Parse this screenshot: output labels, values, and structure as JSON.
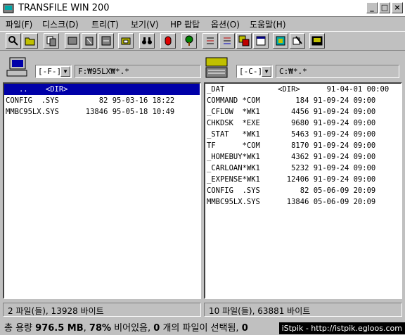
{
  "window": {
    "title": "TRANSFILE WIN 200",
    "minimize": "_",
    "maximize": "□",
    "close": "×"
  },
  "menu": [
    "파일(F)",
    "디스크(D)",
    "트리(T)",
    "보기(V)",
    "HP 팝탑",
    "옵션(O)",
    "도움말(H)"
  ],
  "toolbar_icons": [
    "magnify-icon",
    "open-folder-icon",
    "copy-icon",
    "move-icon",
    "delete-icon",
    "rename-icon",
    "tree-icon",
    "binoculars-icon",
    "stop-icon",
    "tree-view-icon",
    "sort-az-icon",
    "sort-za-icon",
    "tile-icon",
    "calendar-icon",
    "info-icon",
    "connect-icon",
    "exit-icon"
  ],
  "left": {
    "drive": "[-F-]",
    "path": "F:₩95LX₩*.*",
    "files": [
      "   ..    <DIR>",
      "CONFIG  .SYS         82 95-03-16 18:22",
      "MMBC95LX.SYS      13846 95-05-18 10:49"
    ],
    "selected_index": 0,
    "status": "2 파일(들), 13928 바이트"
  },
  "right": {
    "drive": "[-C-]",
    "path": "C:₩*.*",
    "files": [
      "_DAT            <DIR>      91-04-01 00:00",
      "COMMAND *COM        184 91-09-24 09:00",
      "_CFLOW  *WK1       4456 91-09-24 09:00",
      "CHKDSK  *EXE       9680 91-09-24 09:00",
      "_STAT   *WK1       5463 91-09-24 09:00",
      "TF      *COM       8170 91-09-24 09:00",
      "_HOMEBUY*WK1       4362 91-09-24 09:00",
      "_CARLOAN*WK1       5232 91-09-24 09:00",
      "_EXPENSE*WK1      12406 91-09-24 09:00",
      "CONFIG  .SYS         82 05-06-09 20:09",
      "MMBC95LX.SYS      13846 05-06-09 20:09"
    ],
    "status": "10 파일(들), 63881 바이트"
  },
  "bottom": {
    "p1": "총 용량 ",
    "total": "976.5 MB",
    "p2": ", ",
    "pct": "78%",
    "p3": " 비어있음, ",
    "count": "0",
    "p4": " 개의 파일이 선택됨, ",
    "b5": "0"
  },
  "watermark": "iStpik - http://istpik.egloos.com"
}
